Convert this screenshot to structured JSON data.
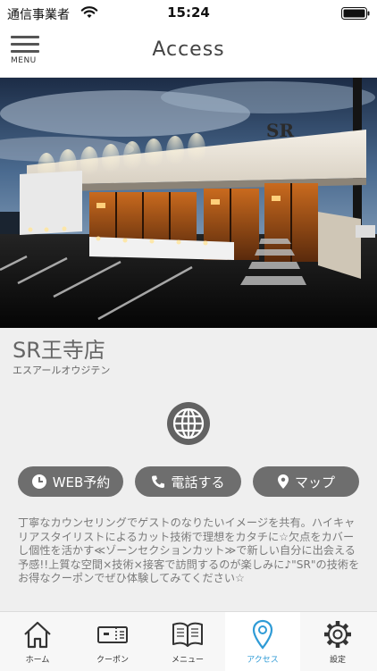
{
  "status_bar": {
    "carrier": "通信事業者",
    "time": "15:24"
  },
  "header": {
    "menu_label": "MENU",
    "title": "Access"
  },
  "hero": {
    "sign_text": "SR"
  },
  "shop": {
    "name": "SR王寺店",
    "kana": "エスアールオウジテン"
  },
  "actions": {
    "web_label": "WEB予約",
    "tel_label": "電話する",
    "map_label": "マップ"
  },
  "description": "丁寧なカウンセリングでゲストのなりたいイメージを共有。ハイキャリアスタイリストによるカット技術で理想をカタチに☆欠点をカバーし個性を活かす≪ゾーンセクションカット≫で新しい自分に出会える予感!!上質な空間×技術×接客で訪問するのが楽しみに♪\"SR\"の技術をお得なクーポンでぜひ体験してみてください☆",
  "tabs": [
    {
      "label": "ホーム",
      "icon": "home-icon"
    },
    {
      "label": "クーポン",
      "icon": "coupon-icon"
    },
    {
      "label": "メニュー",
      "icon": "book-icon"
    },
    {
      "label": "アクセス",
      "icon": "map-pin-icon",
      "active": true
    },
    {
      "label": "設定",
      "icon": "gear-icon"
    }
  ],
  "colors": {
    "accent": "#2f9bd6",
    "pill": "#6e6e6e",
    "background": "#efefef"
  }
}
